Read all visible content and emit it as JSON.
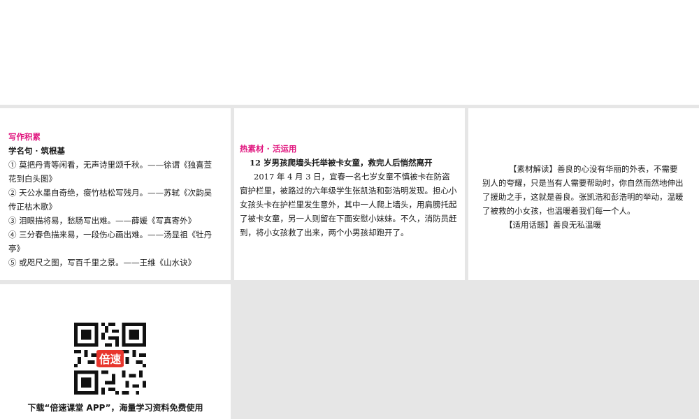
{
  "left_panel": {
    "section_title": "写作积累",
    "subtitle": "学名句 · 筑根基",
    "quotes": [
      "① 莫把丹青等闲看，无声诗里颂千秋。——徐谓《独喜萱花到白头图》",
      "② 天公水墨自奇绝，瘦竹枯松写残月。——苏轼《次韵吴传正枯木歌》",
      "③ 泪眼描将易，愁肠写出难。——薛媛《写真寄外》",
      "④ 三分春色描来易，一段伤心画出难。——汤显祖《牡丹亭》",
      "⑤ 或咫尺之图，写百千里之景。——王维《山水诀》"
    ]
  },
  "middle_panel": {
    "section_title": "热素材 · 活运用",
    "headline": "12 岁男孩爬墙头托举被卡女童，救完人后悄然离开",
    "body": "2017 年 4 月 3 日，宜春一名七岁女童不慎被卡在防盗窗护栏里，被路过的六年级学生张凯浩和彭浩明发现。担心小女孩头卡在护栏里发生意外，其中一人爬上墙头，用肩膀托起了被卡女童，另一人则留在下面安慰小妹妹。不久，消防员赶到，将小女孩救了出来，两个小男孩却跑开了。"
  },
  "right_panel": {
    "interpretation": "【素材解读】善良的心没有华丽的外表，不需要别人的夸耀，只是当有人需要帮助时，你自然而然地伸出了援助之手，这就是善良。张凯浩和彭浩明的举动，温暖了被救的小女孩，也温暖着我们每一个人。",
    "topic": "【适用话题】善良无私温暖"
  },
  "qr_panel": {
    "logo_text": "倍速",
    "caption": "下载“倍速课堂 APP”，海量学习资料免费使用"
  },
  "colors": {
    "accent_pink": "#e0157e",
    "background_gray": "#e6e6e6",
    "qr_logo_red": "#e8362d"
  }
}
